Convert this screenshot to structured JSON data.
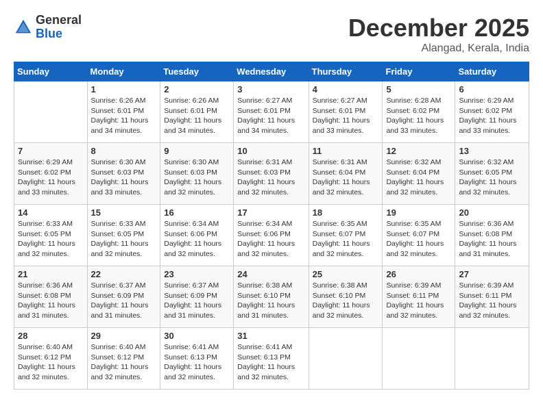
{
  "header": {
    "logo_general": "General",
    "logo_blue": "Blue",
    "month_title": "December 2025",
    "location": "Alangad, Kerala, India"
  },
  "calendar": {
    "days_of_week": [
      "Sunday",
      "Monday",
      "Tuesday",
      "Wednesday",
      "Thursday",
      "Friday",
      "Saturday"
    ],
    "weeks": [
      [
        {
          "day": "",
          "info": ""
        },
        {
          "day": "1",
          "info": "Sunrise: 6:26 AM\nSunset: 6:01 PM\nDaylight: 11 hours and 34 minutes."
        },
        {
          "day": "2",
          "info": "Sunrise: 6:26 AM\nSunset: 6:01 PM\nDaylight: 11 hours and 34 minutes."
        },
        {
          "day": "3",
          "info": "Sunrise: 6:27 AM\nSunset: 6:01 PM\nDaylight: 11 hours and 34 minutes."
        },
        {
          "day": "4",
          "info": "Sunrise: 6:27 AM\nSunset: 6:01 PM\nDaylight: 11 hours and 33 minutes."
        },
        {
          "day": "5",
          "info": "Sunrise: 6:28 AM\nSunset: 6:02 PM\nDaylight: 11 hours and 33 minutes."
        },
        {
          "day": "6",
          "info": "Sunrise: 6:29 AM\nSunset: 6:02 PM\nDaylight: 11 hours and 33 minutes."
        }
      ],
      [
        {
          "day": "7",
          "info": "Sunrise: 6:29 AM\nSunset: 6:02 PM\nDaylight: 11 hours and 33 minutes."
        },
        {
          "day": "8",
          "info": "Sunrise: 6:30 AM\nSunset: 6:03 PM\nDaylight: 11 hours and 33 minutes."
        },
        {
          "day": "9",
          "info": "Sunrise: 6:30 AM\nSunset: 6:03 PM\nDaylight: 11 hours and 32 minutes."
        },
        {
          "day": "10",
          "info": "Sunrise: 6:31 AM\nSunset: 6:03 PM\nDaylight: 11 hours and 32 minutes."
        },
        {
          "day": "11",
          "info": "Sunrise: 6:31 AM\nSunset: 6:04 PM\nDaylight: 11 hours and 32 minutes."
        },
        {
          "day": "12",
          "info": "Sunrise: 6:32 AM\nSunset: 6:04 PM\nDaylight: 11 hours and 32 minutes."
        },
        {
          "day": "13",
          "info": "Sunrise: 6:32 AM\nSunset: 6:05 PM\nDaylight: 11 hours and 32 minutes."
        }
      ],
      [
        {
          "day": "14",
          "info": "Sunrise: 6:33 AM\nSunset: 6:05 PM\nDaylight: 11 hours and 32 minutes."
        },
        {
          "day": "15",
          "info": "Sunrise: 6:33 AM\nSunset: 6:05 PM\nDaylight: 11 hours and 32 minutes."
        },
        {
          "day": "16",
          "info": "Sunrise: 6:34 AM\nSunset: 6:06 PM\nDaylight: 11 hours and 32 minutes."
        },
        {
          "day": "17",
          "info": "Sunrise: 6:34 AM\nSunset: 6:06 PM\nDaylight: 11 hours and 32 minutes."
        },
        {
          "day": "18",
          "info": "Sunrise: 6:35 AM\nSunset: 6:07 PM\nDaylight: 11 hours and 32 minutes."
        },
        {
          "day": "19",
          "info": "Sunrise: 6:35 AM\nSunset: 6:07 PM\nDaylight: 11 hours and 32 minutes."
        },
        {
          "day": "20",
          "info": "Sunrise: 6:36 AM\nSunset: 6:08 PM\nDaylight: 11 hours and 31 minutes."
        }
      ],
      [
        {
          "day": "21",
          "info": "Sunrise: 6:36 AM\nSunset: 6:08 PM\nDaylight: 11 hours and 31 minutes."
        },
        {
          "day": "22",
          "info": "Sunrise: 6:37 AM\nSunset: 6:09 PM\nDaylight: 11 hours and 31 minutes."
        },
        {
          "day": "23",
          "info": "Sunrise: 6:37 AM\nSunset: 6:09 PM\nDaylight: 11 hours and 31 minutes."
        },
        {
          "day": "24",
          "info": "Sunrise: 6:38 AM\nSunset: 6:10 PM\nDaylight: 11 hours and 31 minutes."
        },
        {
          "day": "25",
          "info": "Sunrise: 6:38 AM\nSunset: 6:10 PM\nDaylight: 11 hours and 32 minutes."
        },
        {
          "day": "26",
          "info": "Sunrise: 6:39 AM\nSunset: 6:11 PM\nDaylight: 11 hours and 32 minutes."
        },
        {
          "day": "27",
          "info": "Sunrise: 6:39 AM\nSunset: 6:11 PM\nDaylight: 11 hours and 32 minutes."
        }
      ],
      [
        {
          "day": "28",
          "info": "Sunrise: 6:40 AM\nSunset: 6:12 PM\nDaylight: 11 hours and 32 minutes."
        },
        {
          "day": "29",
          "info": "Sunrise: 6:40 AM\nSunset: 6:12 PM\nDaylight: 11 hours and 32 minutes."
        },
        {
          "day": "30",
          "info": "Sunrise: 6:41 AM\nSunset: 6:13 PM\nDaylight: 11 hours and 32 minutes."
        },
        {
          "day": "31",
          "info": "Sunrise: 6:41 AM\nSunset: 6:13 PM\nDaylight: 11 hours and 32 minutes."
        },
        {
          "day": "",
          "info": ""
        },
        {
          "day": "",
          "info": ""
        },
        {
          "day": "",
          "info": ""
        }
      ]
    ]
  }
}
